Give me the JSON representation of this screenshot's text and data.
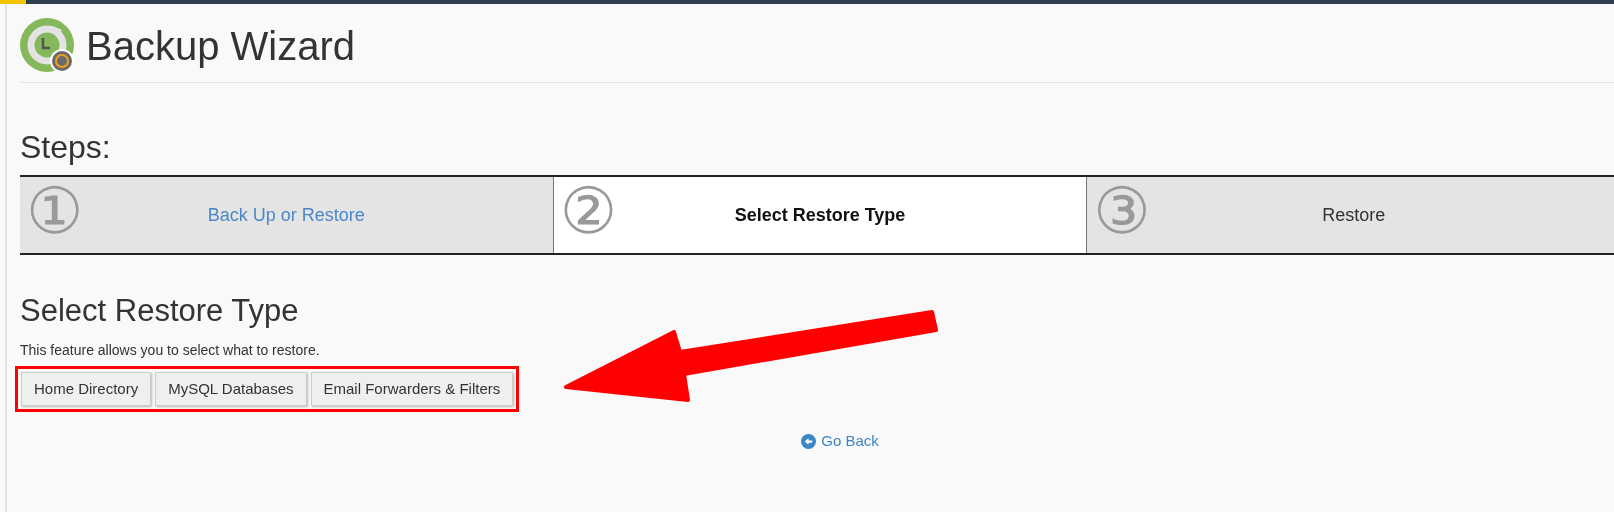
{
  "page": {
    "title": "Backup Wizard"
  },
  "steps_heading": "Steps:",
  "steps": [
    {
      "number": "①",
      "label": "Back Up or Restore",
      "selected": false,
      "linked": true
    },
    {
      "number": "②",
      "label": "Select Restore Type",
      "selected": true,
      "linked": false
    },
    {
      "number": "③",
      "label": "Restore",
      "selected": false,
      "linked": false
    }
  ],
  "section": {
    "heading": "Select Restore Type",
    "description": "This feature allows you to select what to restore."
  },
  "restore_buttons": [
    "Home Directory",
    "MySQL Databases",
    "Email Forwarders & Filters"
  ],
  "go_back": "Go Back"
}
